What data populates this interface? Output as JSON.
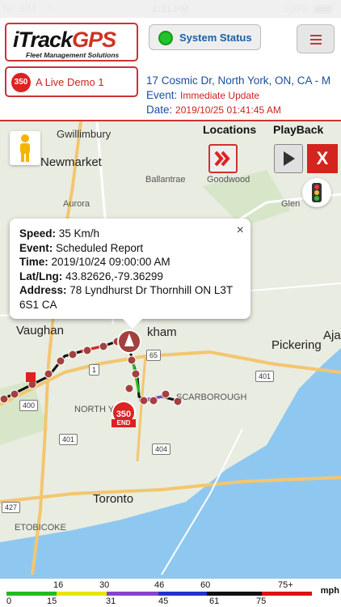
{
  "status_bar": {
    "carrier": "No SIM",
    "time": "2:31 PM",
    "battery": "100%"
  },
  "header": {
    "logo_main_black": "iTrack",
    "logo_main_red": "GPS",
    "logo_sub": "Fleet Management Solutions",
    "system_status_label": "System Status",
    "vehicle_badge": "350",
    "vehicle_name": "A Live Demo 1",
    "address": "17 Cosmic Dr, North York, ON, CA - M",
    "event_label": "Event:",
    "event_value": "Immediate Update",
    "date_label": "Date:",
    "date_value": "2019/10/25 01:41:45 AM"
  },
  "map": {
    "controls": {
      "locations_label": "Locations",
      "playback_label": "PlayBack",
      "close_label": "X"
    },
    "labels": {
      "gwillimbury": "Gwillimbury",
      "newmarket": "Newmarket",
      "ballantrae": "Ballantrae",
      "goodwood": "Goodwood",
      "aurora": "Aurora",
      "glen": "Glen",
      "vaughan": "Vaughan",
      "markham": "kham",
      "pickering": "Pickering",
      "ajax": "Aja",
      "north_york": "NORTH YO",
      "scarborough": "SCARBOROUGH",
      "toronto": "Toronto",
      "etobicoke": "ETOBICOKE",
      "end_label": "END",
      "end_badge": "350"
    },
    "shields": [
      "400",
      "1",
      "65",
      "401",
      "400",
      "401",
      "427",
      "404",
      "1",
      "401"
    ],
    "info": {
      "speed_label": "Speed:",
      "speed_value": "35 Km/h",
      "event_label": "Event:",
      "event_value": "Scheduled Report",
      "time_label": "Time:",
      "time_value": "2019/10/24 09:00:00 AM",
      "latlng_label": "Lat/Lng:",
      "latlng_value": "43.82626,-79.36299",
      "address_label": "Address:",
      "address_value": "78 Lyndhurst Dr Thornhill ON L3T 6S1 CA",
      "close": "×"
    }
  },
  "legend": {
    "top_ticks": [
      "16",
      "30",
      "46",
      "60",
      "75+"
    ],
    "bottom_ticks": [
      "0",
      "15",
      "31",
      "45",
      "61",
      "75"
    ],
    "unit": "mph",
    "colors": [
      "#22bb22",
      "#e6e600",
      "#8844cc",
      "#2233cc",
      "#111111",
      "#dd1111"
    ]
  }
}
